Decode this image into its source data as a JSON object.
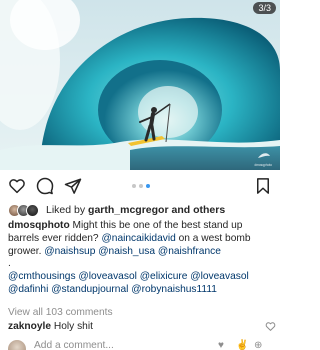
{
  "post": {
    "image_counter": "3/3",
    "watermark": "dmosqphoto",
    "carousel_total": 3,
    "carousel_current": 3
  },
  "actions": {
    "like": "heart-icon",
    "comment": "comment-icon",
    "share": "send-icon",
    "save": "bookmark-icon"
  },
  "likes": {
    "prefix": "Liked by ",
    "user": "garth_mcgregor",
    "suffix": " and others"
  },
  "caption": {
    "author": "dmosqphoto",
    "lines": [
      [
        {
          "t": "Might this be one of the best stand up",
          "tag": false
        }
      ],
      [
        {
          "t": "barrels ever ridden? ",
          "tag": false
        },
        {
          "t": "@naincaikidavid",
          "tag": true
        },
        {
          "t": " on a west bomb",
          "tag": false
        }
      ],
      [
        {
          "t": "grower. ",
          "tag": false
        },
        {
          "t": "@naishsup",
          "tag": true
        },
        {
          "t": " ",
          "tag": false
        },
        {
          "t": "@naish_usa",
          "tag": true
        },
        {
          "t": " ",
          "tag": false
        },
        {
          "t": "@naishfrance",
          "tag": true
        }
      ],
      [
        {
          "t": ".",
          "tag": false
        }
      ],
      [
        {
          "t": "@cmthousings",
          "tag": true
        },
        {
          "t": " ",
          "tag": false
        },
        {
          "t": "@loveavasol",
          "tag": true
        },
        {
          "t": " ",
          "tag": false
        },
        {
          "t": "@elixicure",
          "tag": true
        },
        {
          "t": " ",
          "tag": false
        },
        {
          "t": "@loveavasol",
          "tag": true
        }
      ],
      [
        {
          "t": "@dafinhi",
          "tag": true
        },
        {
          "t": " ",
          "tag": false
        },
        {
          "t": "@standupjournal",
          "tag": true
        },
        {
          "t": " ",
          "tag": false
        },
        {
          "t": "@robynaishus1111",
          "tag": true
        }
      ]
    ]
  },
  "comments": {
    "view_all": "View all 103 comments",
    "top": {
      "user": "zaknoyle",
      "text": " Holy shit"
    }
  },
  "composer": {
    "placeholder": "Add a comment..."
  },
  "colors": {
    "link": "#00376b",
    "muted": "#8e8e8e",
    "dot_active": "#3897f0"
  }
}
